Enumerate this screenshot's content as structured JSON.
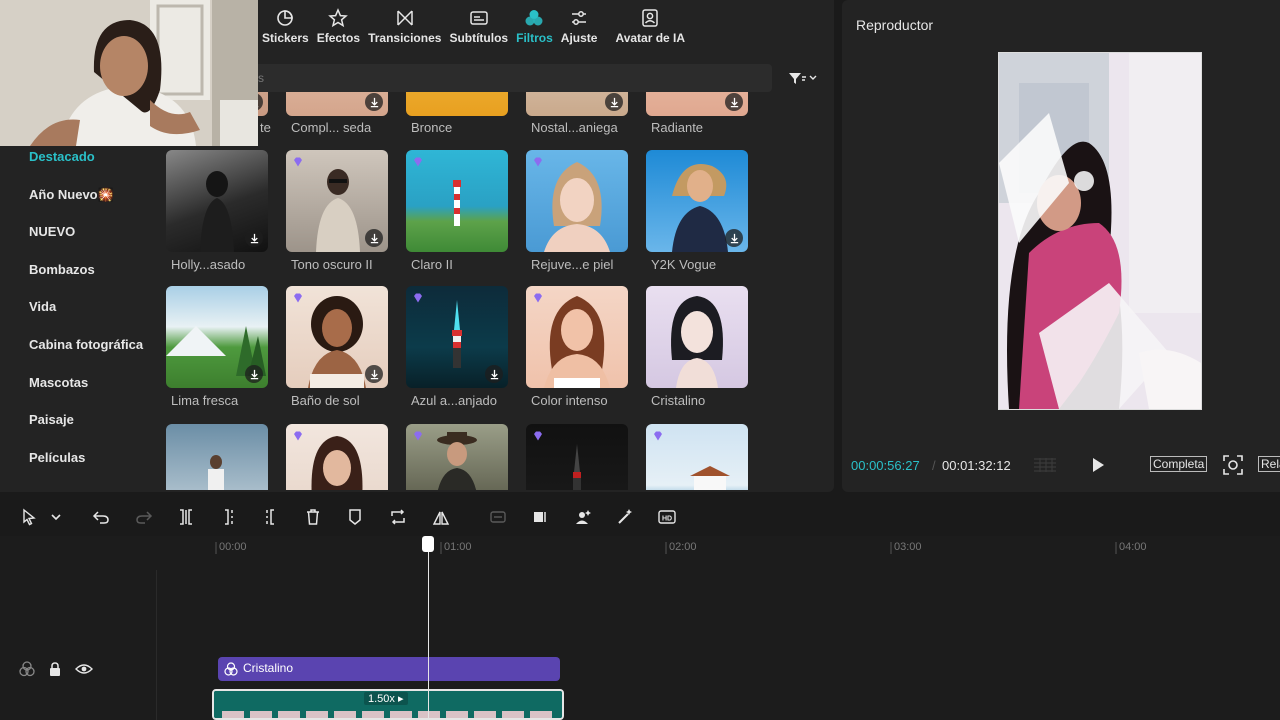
{
  "tabs": [
    {
      "label": "Stickers",
      "icon": "sticker-icon"
    },
    {
      "label": "Efectos",
      "icon": "effects-star-icon"
    },
    {
      "label": "Transiciones",
      "icon": "transition-icon"
    },
    {
      "label": "Subtítulos",
      "icon": "subtitles-icon"
    },
    {
      "label": "Filtros",
      "icon": "filters-icon",
      "active": true
    },
    {
      "label": "Ajuste",
      "icon": "adjust-sliders-icon"
    },
    {
      "label": "Avatar de IA",
      "icon": "ai-avatar-icon"
    }
  ],
  "search": {
    "placeholder": "s"
  },
  "categories": [
    {
      "label": "Destacado",
      "active": true
    },
    {
      "label": "Año Nuevo🎇"
    },
    {
      "label": "NUEVO"
    },
    {
      "label": "Bombazos"
    },
    {
      "label": "Vida"
    },
    {
      "label": "Cabina fotográfica"
    },
    {
      "label": "Mascotas"
    },
    {
      "label": "Paisaje"
    },
    {
      "label": "Películas"
    }
  ],
  "filters_row0": [
    "te",
    "Compl... seda",
    "Bronce",
    "Nostal...aniega",
    "Radiante"
  ],
  "filters_row1": [
    "Holly...asado",
    "Tono oscuro II",
    "Claro II",
    "Rejuve...e piel",
    "Y2K Vogue"
  ],
  "filters_row2": [
    "Lima fresca",
    "Baño de sol",
    "Azul a...anjado",
    "Color intenso",
    "Cristalino"
  ],
  "player": {
    "title": "Reproductor",
    "current_time": "00:00:56:27",
    "total_time": "00:01:32:12",
    "full_label": "Completa",
    "ratio_label": "Rela"
  },
  "timeline": {
    "ticks": [
      "00:00",
      "01:00",
      "02:00",
      "03:00",
      "04:00"
    ],
    "filter_clip_label": "Cristalino",
    "speed_label": "1.50x ▸"
  },
  "colors": {
    "accent": "#2ac0c8",
    "filter_clip": "#5a44b0",
    "video_clip": "#0e6b63"
  }
}
